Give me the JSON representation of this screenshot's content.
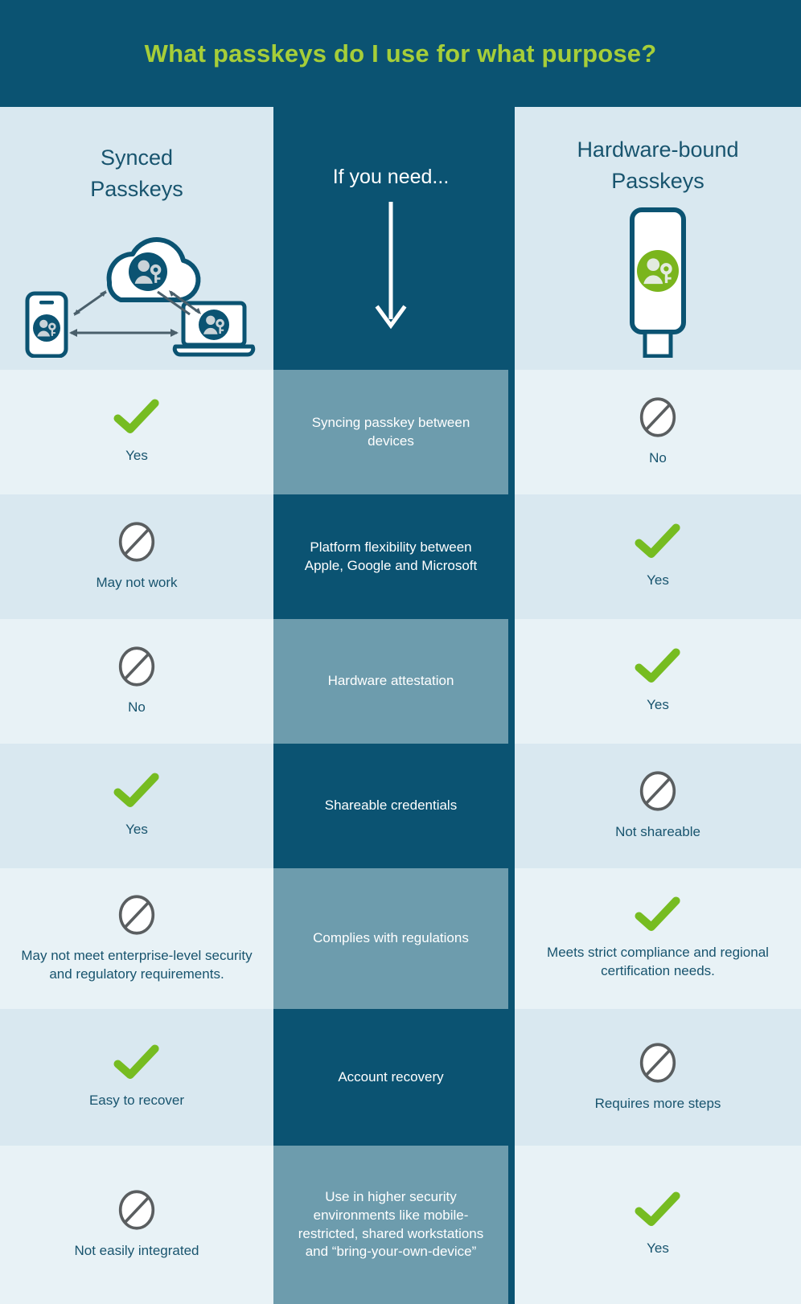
{
  "title": "What passkeys do I use for what purpose?",
  "colors": {
    "brand_teal": "#0b5372",
    "accent_green": "#a6ce39",
    "check_green": "#76bc21",
    "mid_light_teal": "#6d9cad",
    "side_shade_a": "#d9e8f0",
    "side_shade_b": "#e8f2f6",
    "text_teal": "#18546e",
    "no_icon_gray": "#5a5e60"
  },
  "columns": {
    "left": {
      "title": "Synced\nPasskeys",
      "title_line1": "Synced",
      "title_line2": "Passkeys",
      "icon": "cloud-sync-devices-icon"
    },
    "middle": {
      "title": "If you need...",
      "icon": "down-arrow-icon"
    },
    "right": {
      "title_line1": "Hardware-bound",
      "title_line2": "Passkeys",
      "icon": "usb-security-key-icon"
    }
  },
  "rows": [
    {
      "criterion": "Syncing passkey between devices",
      "mid_shade": "light",
      "side_shade": "shadeB",
      "left": {
        "icon": "check-icon",
        "label": "Yes"
      },
      "right": {
        "icon": "no-icon",
        "label": "No"
      }
    },
    {
      "criterion": "Platform flexibility between Apple, Google and Microsoft",
      "mid_shade": "dark",
      "side_shade": "shadeA",
      "left": {
        "icon": "no-icon",
        "label": "May not work"
      },
      "right": {
        "icon": "check-icon",
        "label": "Yes"
      }
    },
    {
      "criterion": "Hardware attestation",
      "mid_shade": "light",
      "side_shade": "shadeB",
      "left": {
        "icon": "no-icon",
        "label": "No"
      },
      "right": {
        "icon": "check-icon",
        "label": "Yes"
      }
    },
    {
      "criterion": "Shareable credentials",
      "mid_shade": "dark",
      "side_shade": "shadeA",
      "left": {
        "icon": "check-icon",
        "label": "Yes"
      },
      "right": {
        "icon": "no-icon",
        "label": "Not shareable"
      }
    },
    {
      "criterion": "Complies with regulations",
      "mid_shade": "light",
      "side_shade": "shadeB",
      "left": {
        "icon": "no-icon",
        "label": "May not meet enterprise-level security and regulatory requirements."
      },
      "right": {
        "icon": "check-icon",
        "label": "Meets strict compliance and regional certification needs."
      }
    },
    {
      "criterion": "Account recovery",
      "mid_shade": "dark",
      "side_shade": "shadeA",
      "left": {
        "icon": "check-icon",
        "label": "Easy to recover"
      },
      "right": {
        "icon": "no-icon",
        "label": "Requires more steps"
      }
    },
    {
      "criterion": "Use in higher security environments like mobile-restricted, shared workstations and “bring-your-own-device”",
      "mid_shade": "light",
      "side_shade": "shadeB",
      "left": {
        "icon": "no-icon",
        "label": "Not easily integrated"
      },
      "right": {
        "icon": "check-icon",
        "label": "Yes"
      }
    }
  ]
}
